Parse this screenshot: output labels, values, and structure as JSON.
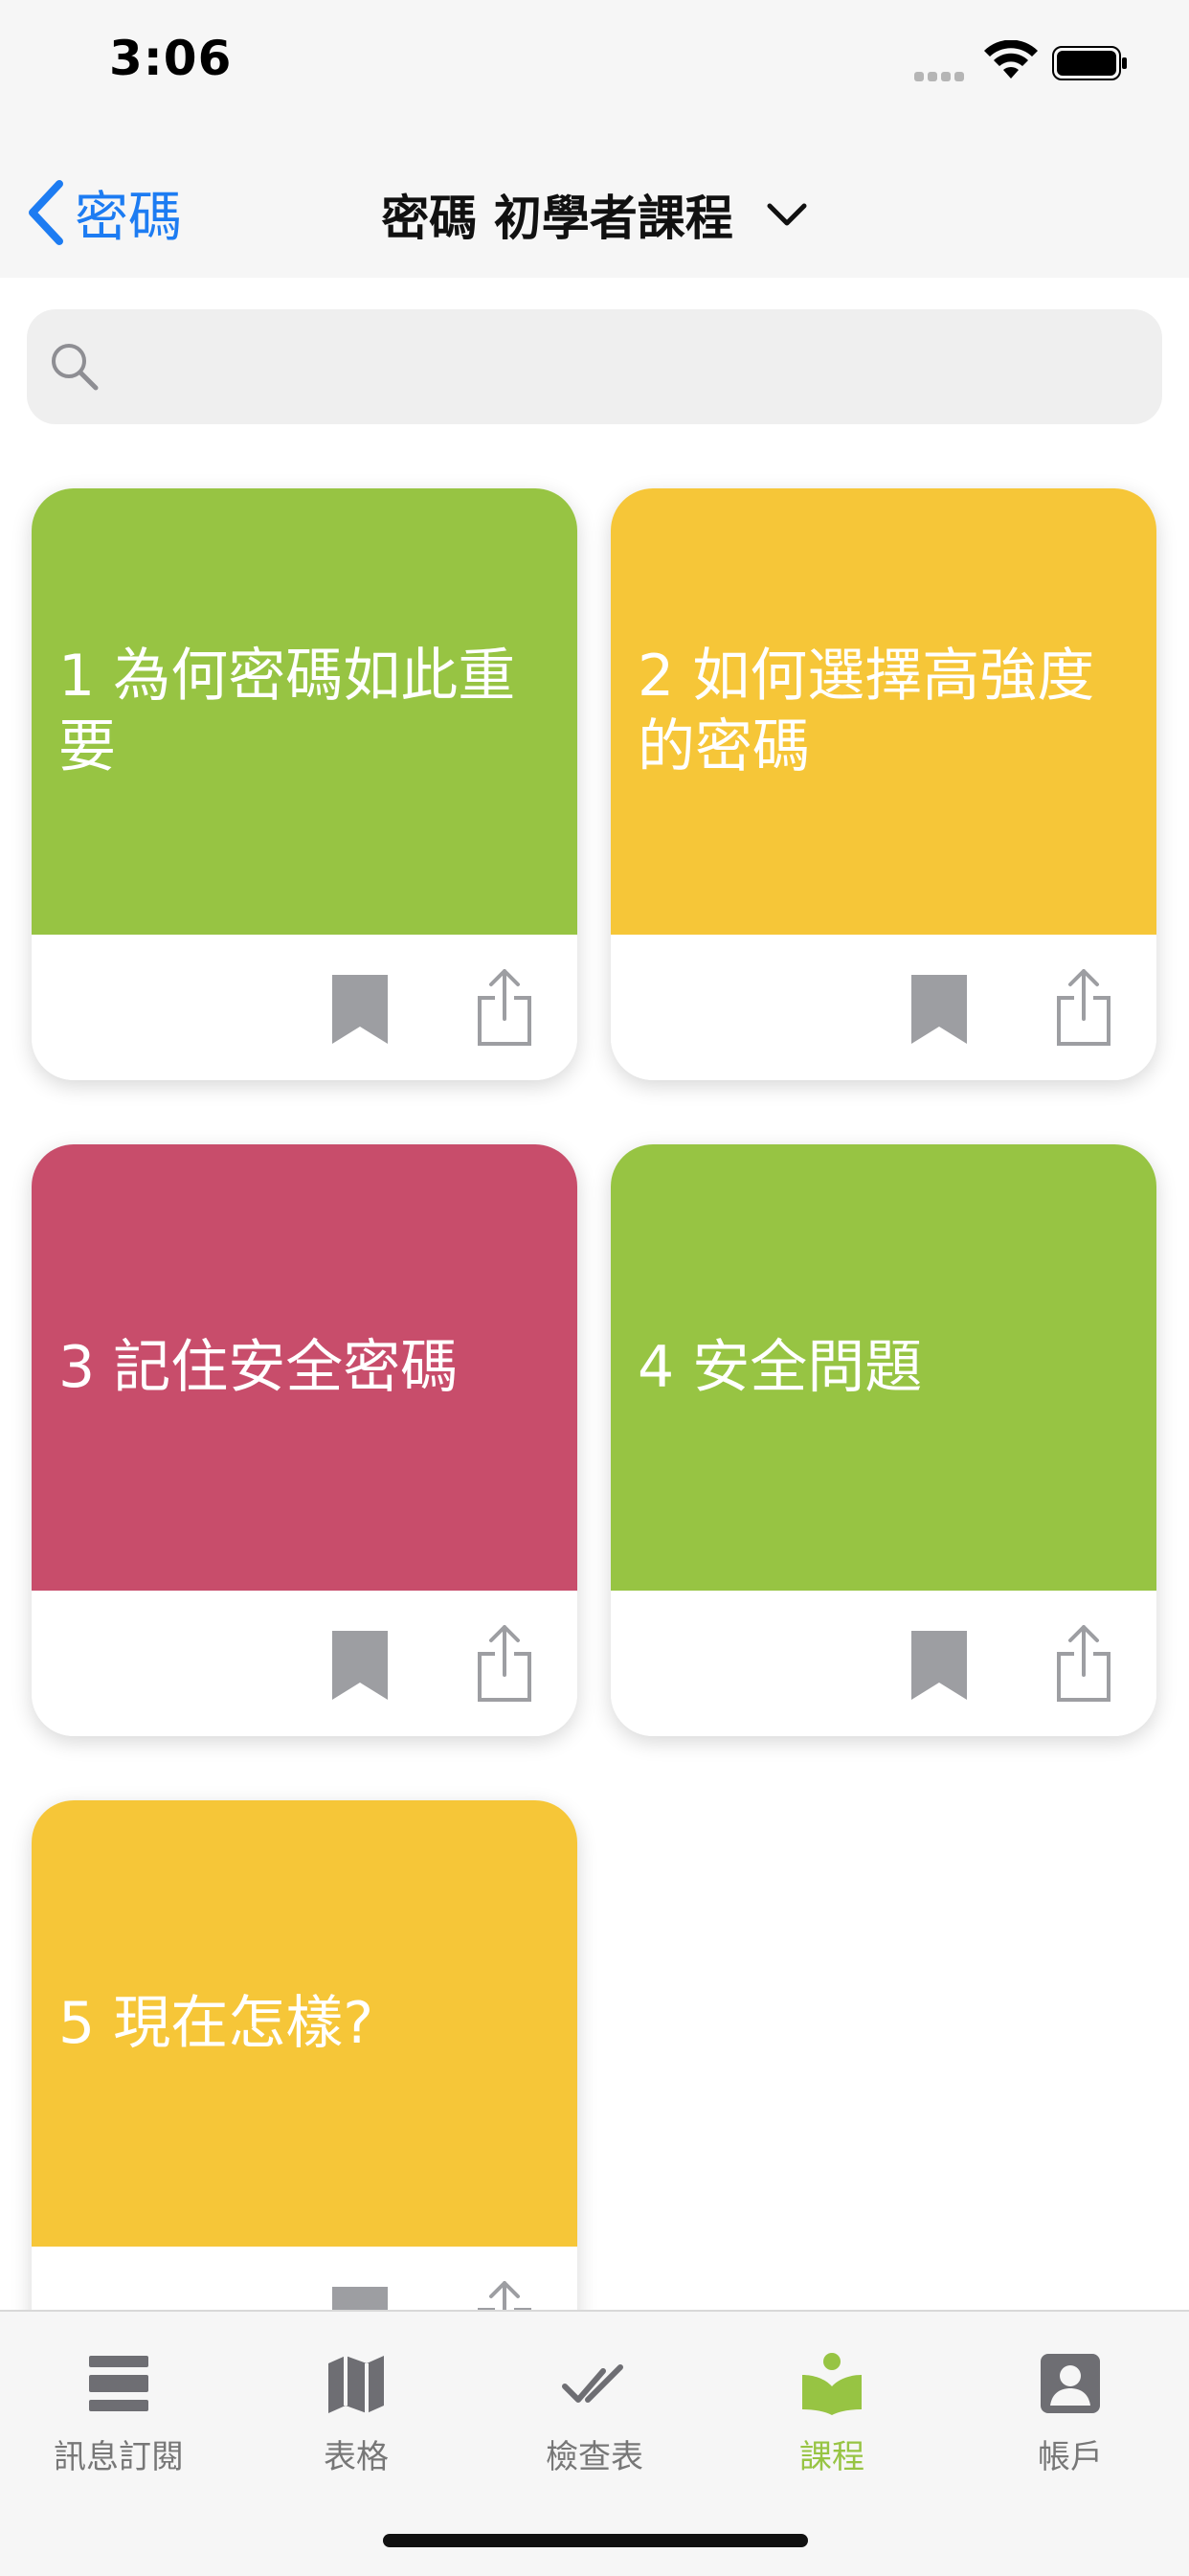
{
  "status_bar": {
    "time": "3:06"
  },
  "nav": {
    "back_label": "密碼",
    "title": "密碼 初學者課程"
  },
  "search": {
    "placeholder": ""
  },
  "colors": {
    "green": "#97c443",
    "yellow": "#f6c638",
    "red": "#c84d6b",
    "accent_blue": "#1d7cf2",
    "icon_gray": "#9d9ea2"
  },
  "lessons": [
    {
      "title": "1 為何密碼如此重要",
      "color": "#97c443"
    },
    {
      "title": "2 如何選擇高強度的密碼",
      "color": "#f6c638"
    },
    {
      "title": "3 記住安全密碼",
      "color": "#c84d6b"
    },
    {
      "title": "4 安全問題",
      "color": "#97c443"
    },
    {
      "title": "5 現在怎樣?",
      "color": "#f6c638"
    }
  ],
  "tabs": [
    {
      "label": "訊息訂閱",
      "icon": "feed-icon",
      "active": false
    },
    {
      "label": "表格",
      "icon": "map-icon",
      "active": false
    },
    {
      "label": "檢查表",
      "icon": "checklist-icon",
      "active": false
    },
    {
      "label": "課程",
      "icon": "course-icon",
      "active": true
    },
    {
      "label": "帳戶",
      "icon": "account-icon",
      "active": false
    }
  ]
}
